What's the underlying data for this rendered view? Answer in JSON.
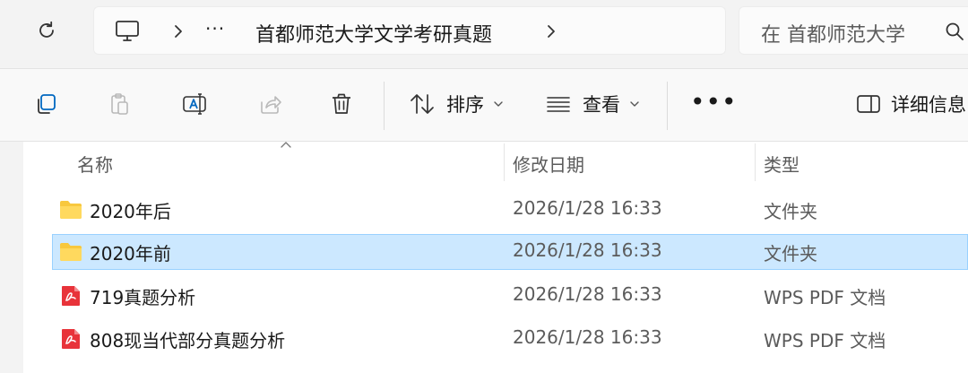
{
  "address_bar": {
    "breadcrumb_overflow": "···",
    "current_folder": "首都师范大学文学考研真题"
  },
  "search": {
    "placeholder": "在 首都师范大学"
  },
  "command_bar": {
    "sort_label": "排序",
    "view_label": "查看",
    "more_label": "•••",
    "details_label": "详细信息"
  },
  "columns": {
    "name": "名称",
    "modified": "修改日期",
    "type": "类型"
  },
  "files": [
    {
      "name": "2020年后",
      "modified": "2026/1/28 16:33",
      "type": "文件夹",
      "icon": "folder-icon",
      "selected": false
    },
    {
      "name": "2020年前",
      "modified": "2026/1/28 16:33",
      "type": "文件夹",
      "icon": "folder-icon",
      "selected": true
    },
    {
      "name": "719真题分析",
      "modified": "2026/1/28 16:33",
      "type": "WPS PDF 文档",
      "icon": "pdf-icon",
      "selected": false
    },
    {
      "name": "808现当代部分真题分析",
      "modified": "2026/1/28 16:33",
      "type": "WPS PDF 文档",
      "icon": "pdf-icon",
      "selected": false
    }
  ],
  "colors": {
    "selection_bg": "#cce8ff",
    "selection_border": "#99d1ff",
    "folder": "#f8c83e",
    "pdf": "#e8333a",
    "accent": "#0067c0"
  }
}
